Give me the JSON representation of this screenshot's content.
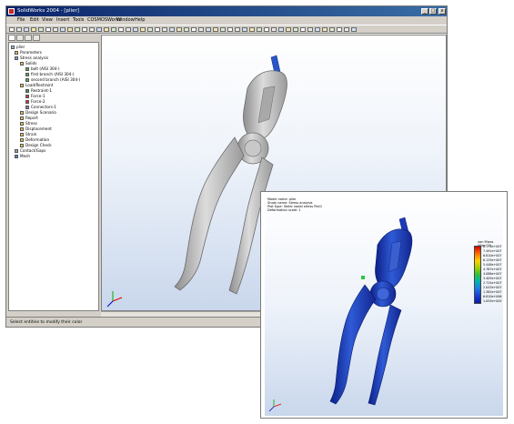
{
  "window": {
    "title": "SolidWorks 2004 - [plier]",
    "minimize": "_",
    "maximize": "□",
    "close": "x",
    "status_text": "Select entities to modify their color"
  },
  "menu": [
    "File",
    "Edit",
    "View",
    "Insert",
    "Tools",
    "COSMOSWorks",
    "Window",
    "Help"
  ],
  "tree": {
    "items": [
      {
        "label": "plier",
        "icon": "part-icon",
        "indent": 0
      },
      {
        "label": "Parameters",
        "icon": "folder-icon",
        "indent": 1
      },
      {
        "label": "Stress analysis",
        "icon": "study-icon",
        "indent": 1
      },
      {
        "label": "Solids",
        "icon": "solids-icon",
        "indent": 2
      },
      {
        "label": "bolt (AISI 304-)",
        "icon": "solid-body-icon",
        "indent": 3
      },
      {
        "label": "first branch (AISI 304-)",
        "icon": "solid-body-icon",
        "indent": 3
      },
      {
        "label": "second branch (AISI 304-)",
        "icon": "solid-body-icon",
        "indent": 3
      },
      {
        "label": "Load/Restraint",
        "icon": "loads-icon",
        "indent": 2
      },
      {
        "label": "Restraint-1",
        "icon": "restraint-icon",
        "indent": 3
      },
      {
        "label": "Force-1",
        "icon": "force-icon",
        "indent": 3
      },
      {
        "label": "Force-2",
        "icon": "force-icon",
        "indent": 3
      },
      {
        "label": "Connectors-1",
        "icon": "connector-icon",
        "indent": 3
      },
      {
        "label": "Design Scenario",
        "icon": "scenario-icon",
        "indent": 2
      },
      {
        "label": "Report",
        "icon": "report-icon",
        "indent": 2
      },
      {
        "label": "Stress",
        "icon": "result-icon",
        "indent": 2
      },
      {
        "label": "Displacement",
        "icon": "result-icon",
        "indent": 2
      },
      {
        "label": "Strain",
        "icon": "result-icon",
        "indent": 2
      },
      {
        "label": "Deformation",
        "icon": "result-icon",
        "indent": 2
      },
      {
        "label": "Design Check",
        "icon": "result-icon",
        "indent": 2
      },
      {
        "label": "Contact/Gaps",
        "icon": "contact-icon",
        "indent": 2
      },
      {
        "label": "Mesh",
        "icon": "mesh-icon",
        "indent": 2
      }
    ]
  },
  "result_window": {
    "info_lines": [
      "Model name: plier",
      "Study name: Stress analysis",
      "Plot type: Static nodal stress Plot1",
      "Deformation scale: 1"
    ],
    "legend_title": "von Mises (N/m^2)",
    "legend_values": [
      "8.173e+007",
      "7.491e+007",
      "6.810e+007",
      "6.129e+007",
      "5.448e+007",
      "4.767e+007",
      "4.086e+007",
      "3.405e+007",
      "2.724e+007",
      "2.043e+007",
      "1.362e+007",
      "6.810e+006",
      "1.055e+003"
    ]
  },
  "colors": {
    "model_gray": "#b9b9b9",
    "model_blue": "#1e3fa8",
    "title_blue": "#0a246a"
  }
}
